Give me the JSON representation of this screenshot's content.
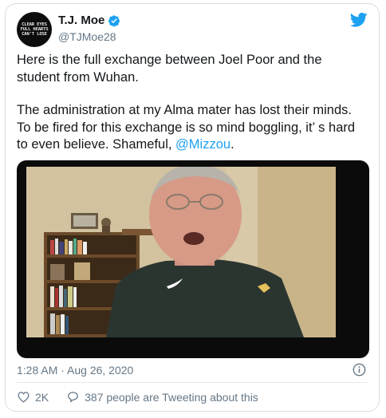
{
  "tweet": {
    "avatar_text": "CLEAR EYES\nFULL HEARTS\nCAN'T LOSE",
    "name": "T.J. Moe",
    "handle": "@TJMoe28",
    "paragraph1": "Here is the full exchange between Joel Poor and the student from Wuhan.",
    "paragraph2_text": "The administration at my Alma mater has lost their minds. To be fired for this exchange is so mind boggling, it’ s hard to even believe. Shameful, ",
    "mention": "@Mizzou",
    "paragraph2_end": ".",
    "timestamp": "1:28 AM · Aug 26, 2020",
    "likes": "2K",
    "reply_text": "387 people are Tweeting about this"
  },
  "colors": {
    "accent": "#1da1f2",
    "secondary_text": "#657786",
    "like_red": "#e0245e"
  },
  "icons": [
    "verified-badge-icon",
    "twitter-bird-icon",
    "info-icon",
    "heart-icon",
    "reply-bubble-icon"
  ]
}
